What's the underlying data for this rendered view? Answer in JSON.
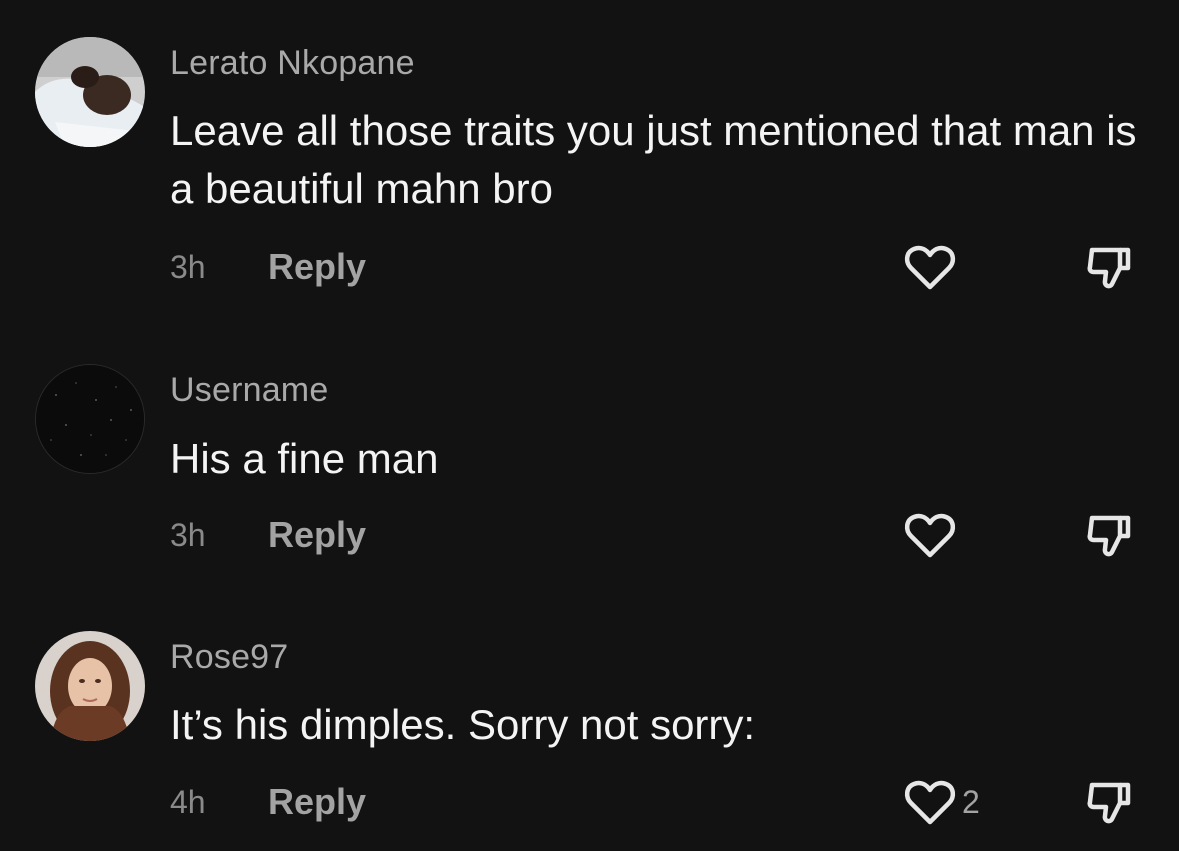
{
  "comments": [
    {
      "avatar": "profile-photo-man",
      "username": "Lerato Nkopane",
      "text": "Leave all those traits you just mentioned that man is a beautiful mahn bro",
      "time": "3h",
      "reply_label": "Reply",
      "like_icon": "heart-outline-icon",
      "dislike_icon": "thumbs-down-icon"
    },
    {
      "avatar": "starry-black-image",
      "username": "Username",
      "text": "His a fine man",
      "time": "3h",
      "reply_label": "Reply",
      "like_icon": "heart-outline-icon",
      "dislike_icon": "thumbs-down-icon"
    },
    {
      "avatar": "profile-photo-woman",
      "username": "Rose97",
      "text": "It’s his dimples. Sorry not sorry:",
      "time": "4h",
      "reply_label": "Reply",
      "like_count": "2",
      "like_icon": "heart-outline-icon",
      "dislike_icon": "thumbs-down-icon"
    }
  ],
  "colors": {
    "background": "#121212",
    "username": "#a9a9a9",
    "text": "#f4f4f4",
    "meta": "#8a8a8a",
    "icon": "#e6e6e6"
  }
}
